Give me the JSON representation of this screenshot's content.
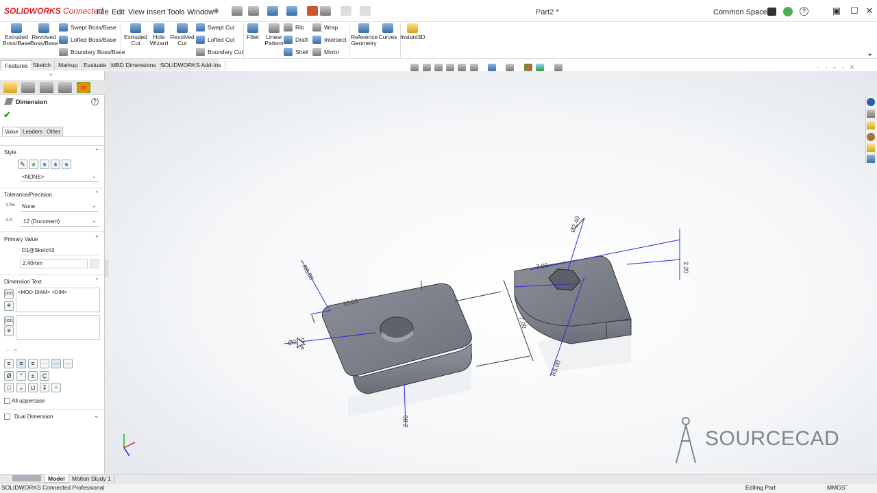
{
  "app": {
    "logo_brand": "SOLIDWORKS",
    "logo_suffix": "Connected",
    "document_title": "Part2 *",
    "workspace": "Common Space",
    "menu": [
      "File",
      "Edit",
      "View",
      "Insert",
      "Tools",
      "Window"
    ]
  },
  "commands": {
    "extruded_boss": "Extruded Boss/Base",
    "revolved_boss": "Revolved Boss/Base",
    "swept_boss": "Swept Boss/Base",
    "lofted_boss": "Lofted Boss/Base",
    "boundary_boss": "Boundary Boss/Base",
    "extruded_cut": "Extruded Cut",
    "hole_wizard": "Hole Wizard",
    "revolved_cut": "Revolved Cut",
    "swept_cut": "Swept Cut",
    "lofted_cut": "Lofted Cut",
    "boundary_cut": "Boundary Cut",
    "fillet": "Fillet",
    "linear_pattern": "Linear Pattern",
    "rib": "Rib",
    "draft": "Draft",
    "shell": "Shell",
    "wrap": "Wrap",
    "intersect": "Intersect",
    "mirror": "Mirror",
    "reference_geometry": "Reference Geometry",
    "curves": "Curves",
    "instant3d": "Instant3D"
  },
  "cmd_tabs": [
    "Features",
    "Sketch",
    "Markup",
    "Evaluate",
    "MBD Dimensions",
    "SOLIDWORKS Add-Ins"
  ],
  "panel": {
    "title": "Dimension",
    "subtabs": [
      "Value",
      "Leaders",
      "Other"
    ],
    "style_label": "Style",
    "style_value": "<NONE>",
    "tolerance_label": "Tolerance/Precision",
    "tolerance_value": "None",
    "precision_value": ".12 (Document)",
    "primary_label": "Primary Value",
    "primary_name": "D1@Sketch3",
    "primary_value": "2.40mm",
    "dimtext_label": "Dimension Text",
    "dimtext_value": "<MOD-DIAM> <DIM>",
    "all_uppercase": "All uppercase",
    "dual_dimension": "Dual Dimension"
  },
  "viewport": {
    "dims": {
      "r080": "R0.80",
      "d1000": "10.00",
      "hole": "Ø2.40",
      "d200": "2.00",
      "dia240": "Ø2.40",
      "d700": "7.00",
      "d220": "2.20",
      "d700b": "7.00",
      "r500": "R5.00"
    },
    "watermark": "SOURCECAD"
  },
  "bottom_tabs": [
    "Model",
    "Motion Study 1"
  ],
  "status": {
    "product": "SOLIDWORKS Connected Professional",
    "mode": "Editing Part",
    "units": "MMGS"
  },
  "colors": {
    "brand": "#d42027",
    "dimension": "#2c2cd6",
    "part": "#7b8089"
  }
}
